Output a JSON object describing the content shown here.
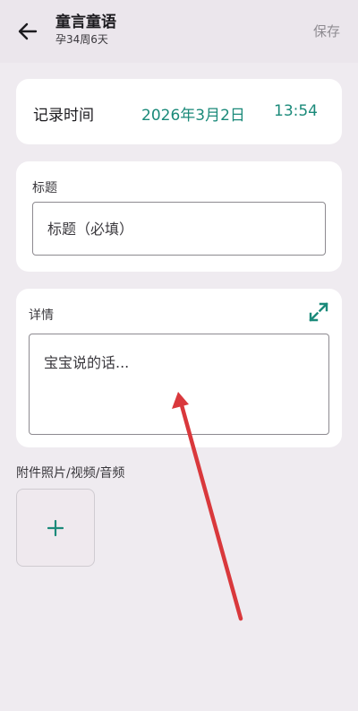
{
  "header": {
    "title": "童言童语",
    "subtitle": "孕34周6天",
    "save_label": "保存"
  },
  "record_time": {
    "label": "记录时间",
    "date": "2026年3月2日",
    "time": "13:54"
  },
  "title_field": {
    "label": "标题",
    "placeholder": "标题（必填）",
    "value": ""
  },
  "detail_field": {
    "label": "详情",
    "placeholder": "宝宝说的话...",
    "value": ""
  },
  "attachments": {
    "label": "附件照片/视频/音频"
  },
  "icons": {
    "back": "arrow-left-icon",
    "expand": "expand-diagonal-icon",
    "add": "plus-icon"
  },
  "colors": {
    "accent": "#1b8a7a",
    "background": "#efebf0",
    "card": "#ffffff",
    "annotation_arrow": "#d9383c"
  }
}
